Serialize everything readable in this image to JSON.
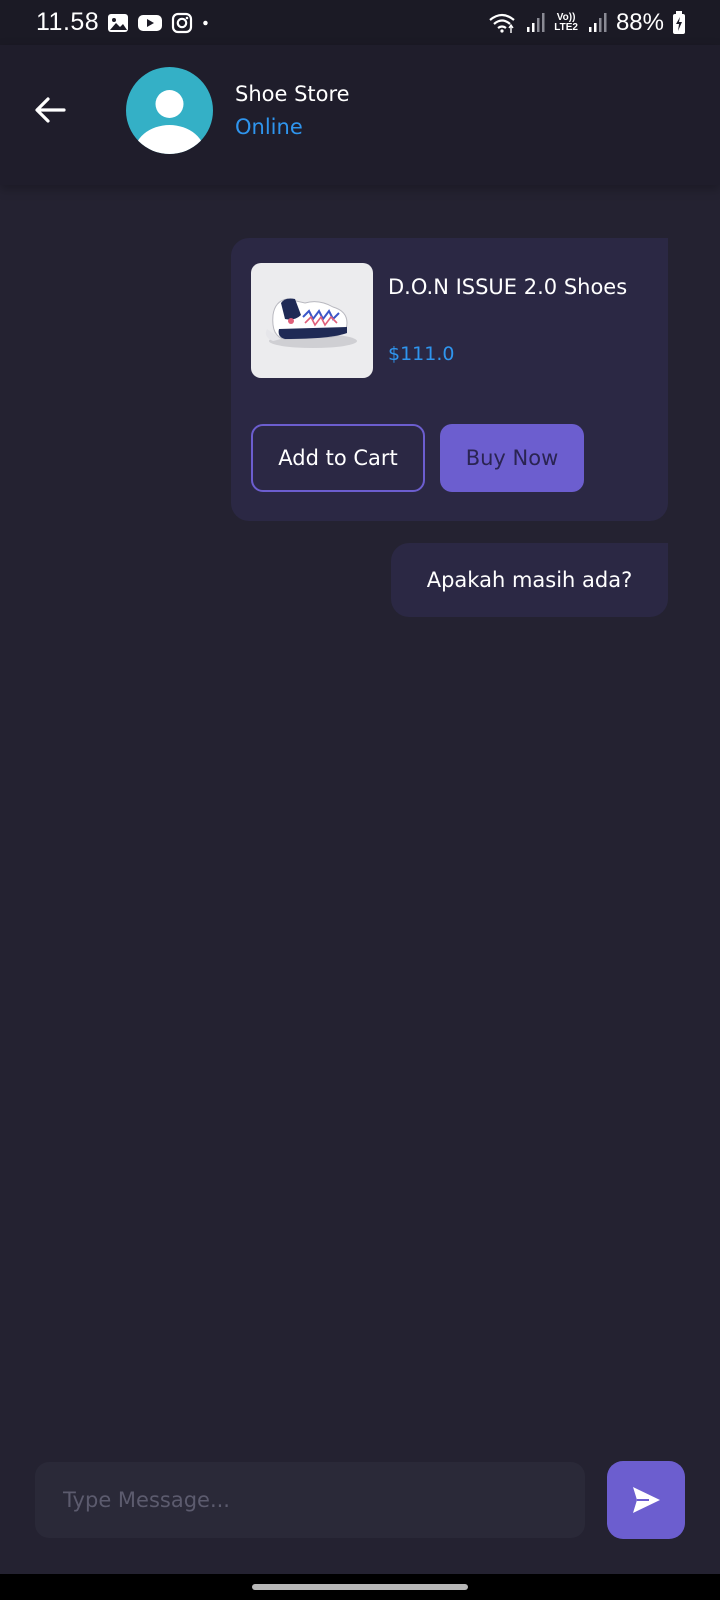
{
  "status_bar": {
    "time": "11.58",
    "battery": "88%",
    "lte_top": "Vo))",
    "lte_bottom": "LTE2",
    "icons": [
      "gallery-icon",
      "youtube-icon",
      "instagram-icon",
      "dot-icon",
      "wifi-icon",
      "signal-icon",
      "battery-icon"
    ]
  },
  "header": {
    "store_name": "Shoe Store",
    "status": "Online",
    "icons": [
      "back-arrow-icon",
      "person-icon"
    ]
  },
  "messages": {
    "product": {
      "name": "D.O.N ISSUE 2.0 Shoes",
      "price": "$111.0",
      "add_to_cart_label": "Add to Cart",
      "buy_now_label": "Buy Now"
    },
    "text": "Apakah masih ada?"
  },
  "input": {
    "placeholder": "Type Message...",
    "value": "",
    "send_icon": "send-icon"
  },
  "colors": {
    "background": "#242231",
    "header": "#1f1d2b",
    "bubble": "#2b2844",
    "accent": "#6c5ecf",
    "link": "#2f95ee",
    "avatar": "#34b0c6"
  }
}
